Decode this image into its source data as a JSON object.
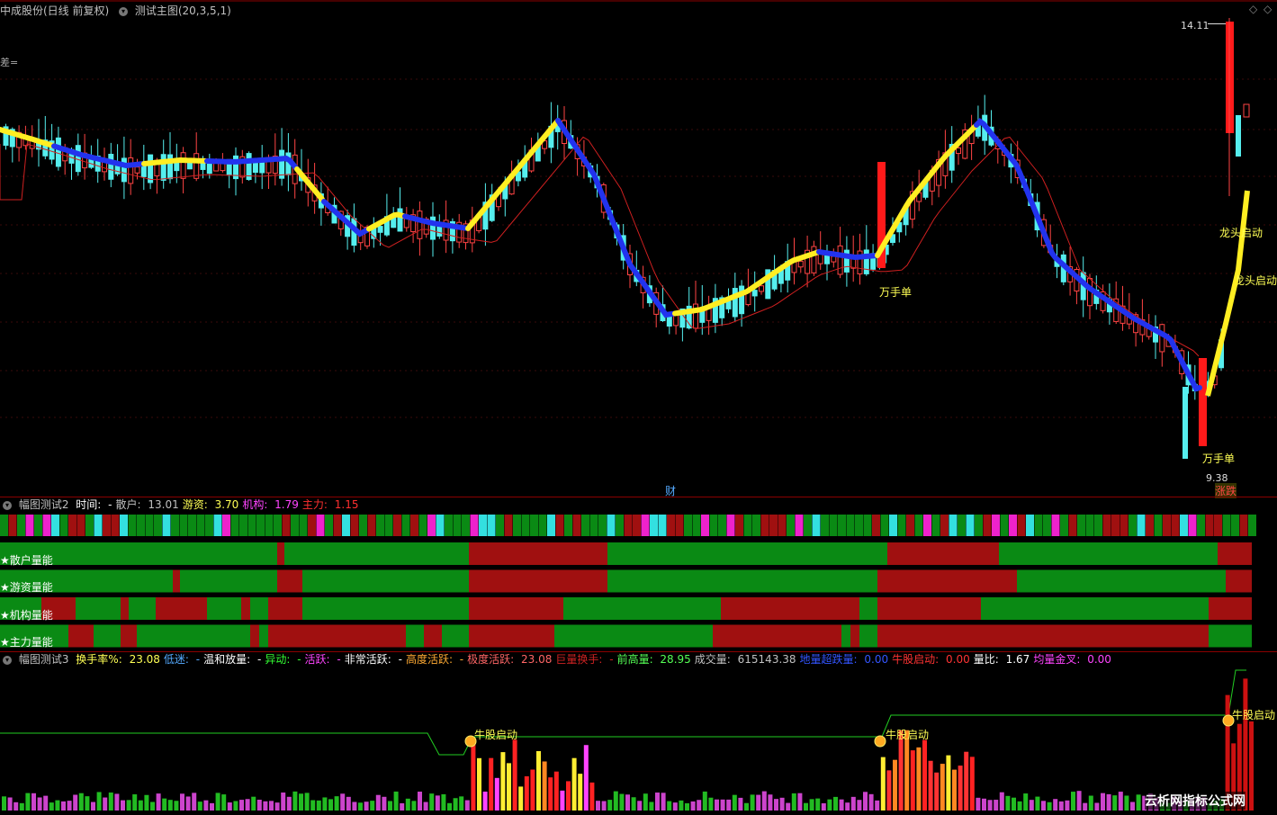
{
  "main_pane": {
    "title": "中成股份(日线 前复权)",
    "indicator": "测试主图(20,3,5,1)",
    "left_label": "差=",
    "high_label": "14.11",
    "low_label": "9.38",
    "annotations": [
      "万手单",
      "万手单",
      "龙头启动",
      "龙头启动",
      "财",
      "涨跌"
    ]
  },
  "pane2": {
    "title": "幅图测试2",
    "fields": [
      {
        "label": "时间:",
        "value": "-",
        "color": "#ffffff"
      },
      {
        "label": "散户:",
        "value": "13.01",
        "color": "#c0c0c0"
      },
      {
        "label": "游资:",
        "value": "3.70",
        "color": "#ffff55"
      },
      {
        "label": "机构:",
        "value": "1.79",
        "color": "#ff44ff"
      },
      {
        "label": "主力:",
        "value": "1.15",
        "color": "#ff3030"
      }
    ],
    "rows": [
      "★散户量能",
      "★游资量能",
      "★机构量能",
      "★主力量能"
    ]
  },
  "pane3": {
    "title": "幅图测试3",
    "fields": [
      {
        "label": "换手率%:",
        "value": "23.08",
        "color": "#ffff55"
      },
      {
        "label": "低迷:",
        "value": "-",
        "color": "#55aaff"
      },
      {
        "label": "温和放量:",
        "value": "-",
        "color": "#ffffff"
      },
      {
        "label": "异动:",
        "value": "-",
        "color": "#33ff33"
      },
      {
        "label": "活跃:",
        "value": "-",
        "color": "#ff44ff"
      },
      {
        "label": "非常活跃:",
        "value": "-",
        "color": "#ffffff"
      },
      {
        "label": "高度活跃:",
        "value": "-",
        "color": "#ffaa33"
      },
      {
        "label": "极度活跃:",
        "value": "23.08",
        "color": "#ff6666"
      },
      {
        "label": "巨量换手:",
        "value": "-",
        "color": "#cc2222"
      },
      {
        "label": "前高量:",
        "value": "28.95",
        "color": "#55ff55"
      },
      {
        "label": "成交量:",
        "value": "615143.38",
        "color": "#c0c0c0"
      },
      {
        "label": "地量超跌量:",
        "value": "0.00",
        "color": "#3355ff"
      },
      {
        "label": "牛股启动:",
        "value": "0.00",
        "color": "#ff3333"
      },
      {
        "label": "量比:",
        "value": "1.67",
        "color": "#ffffff"
      },
      {
        "label": "均量金叉:",
        "value": "0.00",
        "color": "#ff44ff"
      }
    ],
    "markers": [
      "牛股启动",
      "牛股启动",
      "牛股启动"
    ]
  },
  "watermark": "云析网指标公式网"
}
